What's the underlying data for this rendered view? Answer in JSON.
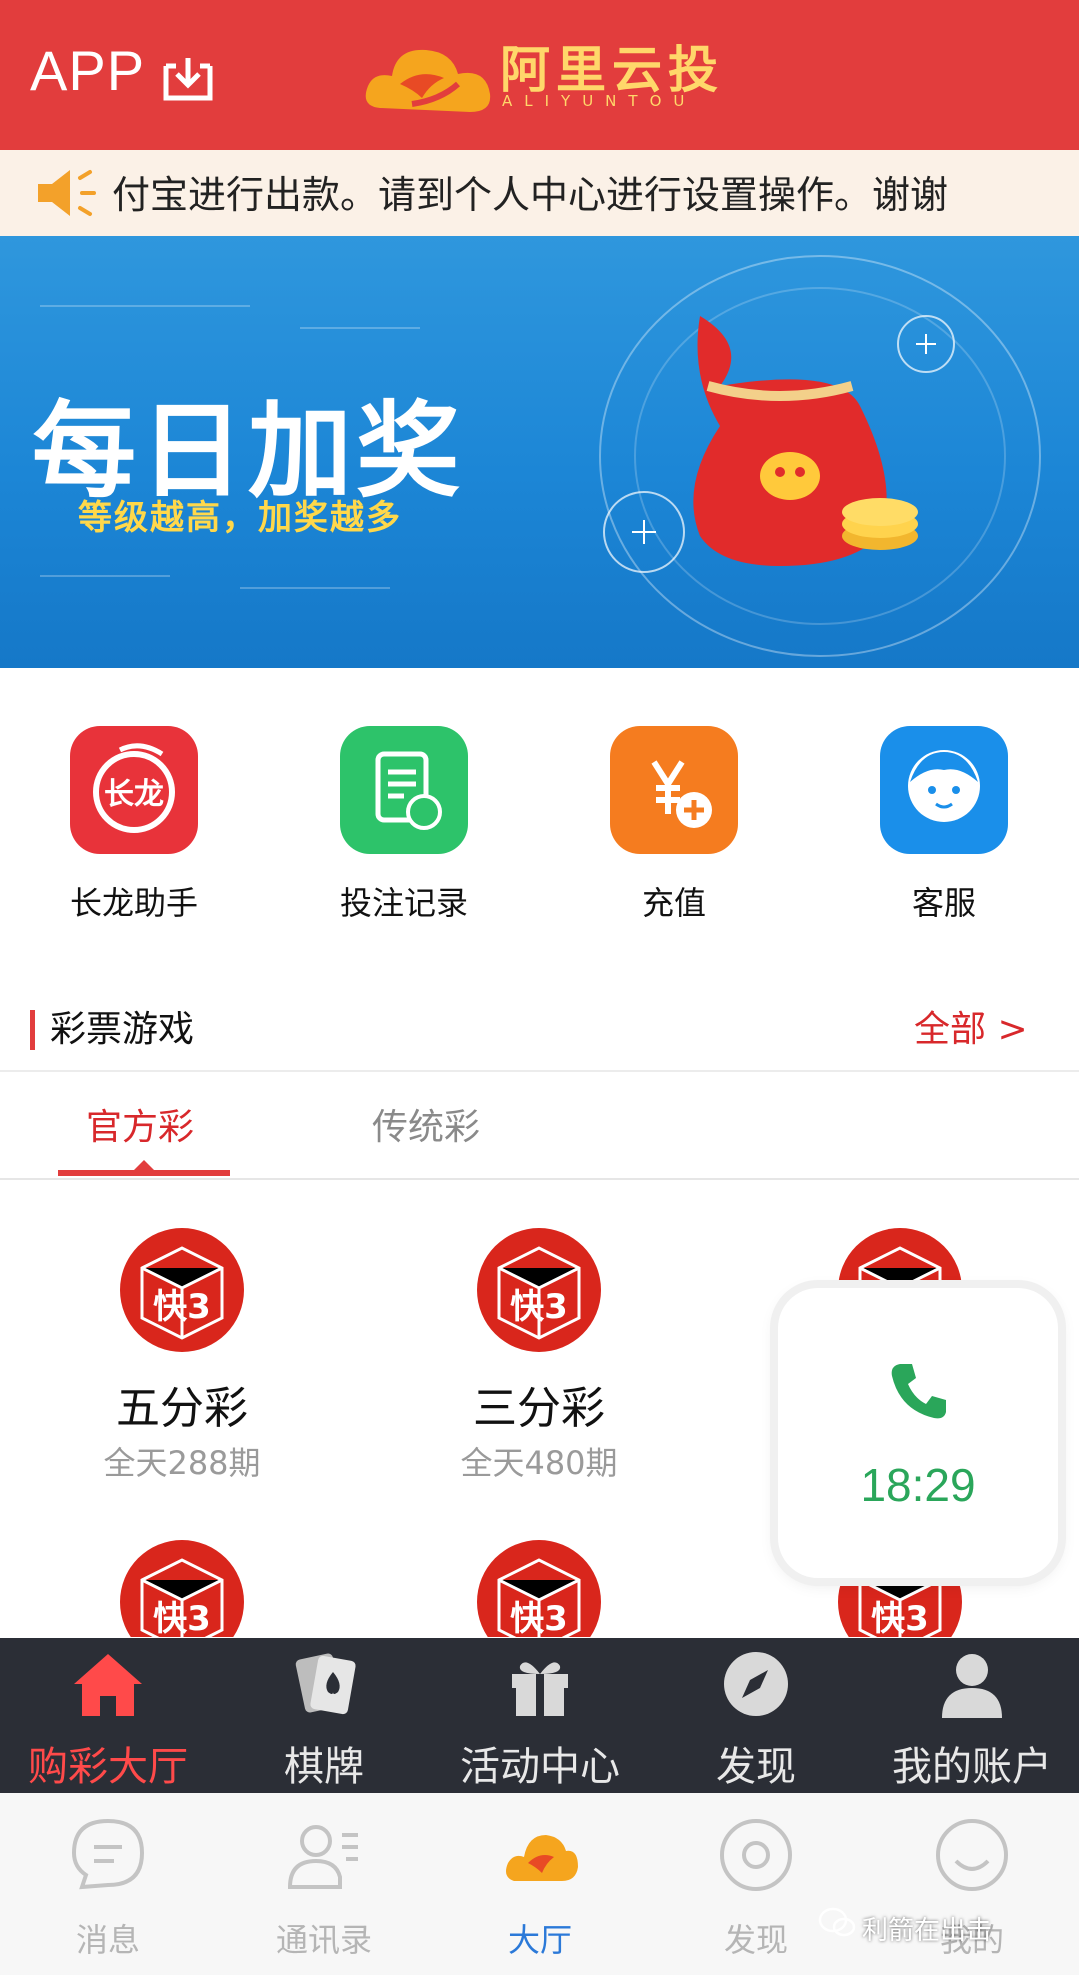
{
  "header": {
    "app_label": "APP",
    "logo_title": "阿里云投",
    "logo_sub": "ALIYUNTOU"
  },
  "notice": {
    "text": "付宝进行出款。请到个人中心进行设置操作。谢谢"
  },
  "banner": {
    "headline": "每日加奖",
    "tagline": "等级越高，加奖越多"
  },
  "quick": [
    {
      "label": "长龙助手",
      "icon": "dragon-icon",
      "icon_text": "长龙",
      "color": "#e8333a"
    },
    {
      "label": "投注记录",
      "icon": "record-icon",
      "color": "#2dc36a"
    },
    {
      "label": "充值",
      "icon": "yuan-plus-icon",
      "color": "#f57c1f"
    },
    {
      "label": "客服",
      "icon": "service-icon",
      "color": "#1a8fea"
    }
  ],
  "lottery": {
    "title": "彩票游戏",
    "all_link": "全部 >",
    "tabs": [
      "官方彩",
      "传统彩"
    ]
  },
  "games": [
    {
      "name": "五分彩",
      "sub": "全天288期"
    },
    {
      "name": "三分彩",
      "sub": "全天480期"
    }
  ],
  "dice_text": "快3",
  "call": {
    "time": "18:29"
  },
  "app_nav": [
    {
      "label": "购彩大厅",
      "icon": "home-icon"
    },
    {
      "label": "棋牌",
      "icon": "cards-icon"
    },
    {
      "label": "活动中心",
      "icon": "gift-icon"
    },
    {
      "label": "发现",
      "icon": "compass-icon"
    },
    {
      "label": "我的账户",
      "icon": "user-icon"
    }
  ],
  "wechat_nav": [
    {
      "label": "消息",
      "icon": "chat-icon"
    },
    {
      "label": "通讯录",
      "icon": "contacts-icon"
    },
    {
      "label": "大厅",
      "icon": "lobby-icon"
    },
    {
      "label": "发现",
      "icon": "discover-icon"
    },
    {
      "label": "我的",
      "icon": "me-icon"
    }
  ],
  "watermark": "利箭在出击",
  "colors": {
    "brand_red": "#e23d3d",
    "banner_blue": "#1c86d6",
    "call_green": "#2aa65a",
    "wechat_active": "#2b79d8"
  }
}
